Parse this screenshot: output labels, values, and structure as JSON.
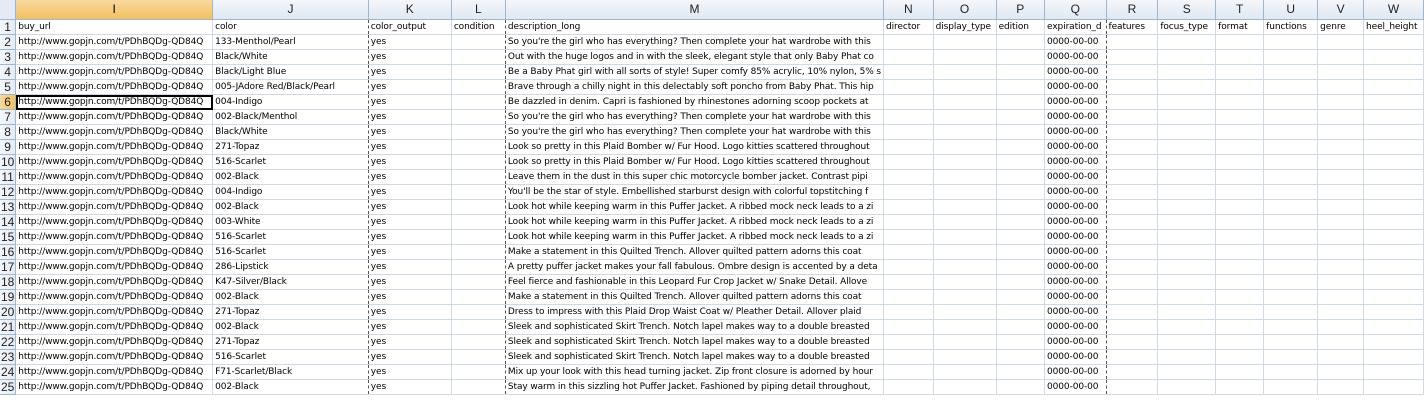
{
  "columns": [
    "I",
    "J",
    "K",
    "L",
    "M",
    "N",
    "O",
    "P",
    "Q",
    "R",
    "S",
    "T",
    "U",
    "V",
    "W"
  ],
  "headers": [
    "buy_url",
    "color",
    "color_output",
    "condition",
    "description_long",
    "director",
    "display_type",
    "edition",
    "expiration_d",
    "features",
    "focus_type",
    "format",
    "functions",
    "genre",
    "heel_height"
  ],
  "rows": [
    {
      "num": "1",
      "url": "buy_url",
      "color": "color",
      "out": "color_output",
      "desc": "description_long",
      "exp": "expiration_d"
    },
    {
      "num": "2",
      "url": "http://www.gopjn.com/t/PDhBQDg-QD84Q",
      "color": "133-Menthol/Pearl",
      "out": "yes",
      "desc": "So you're the girl who has everything? Then complete your hat wardrobe with this",
      "exp": "0000-00-00"
    },
    {
      "num": "3",
      "url": "http://www.gopjn.com/t/PDhBQDg-QD84Q",
      "color": "Black/White",
      "out": "yes",
      "desc": "Out with the huge logos and in with the sleek, elegant style that only Baby Phat co",
      "exp": "0000-00-00"
    },
    {
      "num": "4",
      "url": "http://www.gopjn.com/t/PDhBQDg-QD84Q",
      "color": "Black/Light Blue",
      "out": "yes",
      "desc": "Be a Baby Phat girl with all sorts of style! Super comfy 85% acrylic, 10% nylon, 5% s",
      "exp": "0000-00-00"
    },
    {
      "num": "5",
      "url": "http://www.gopjn.com/t/PDhBQDg-QD84Q",
      "color": "005-JAdore Red/Black/Pearl",
      "out": "yes",
      "desc": "Brave through a chilly night in this delectably soft poncho from Baby Phat. This hip",
      "exp": "0000-00-00"
    },
    {
      "num": "6",
      "url": "http://www.gopjn.com/t/PDhBQDg-QD84Q",
      "color": "004-Indigo",
      "out": "yes",
      "desc": "Be dazzled in denim.  Capri is fashioned by rhinestones adorning scoop pockets at",
      "exp": "0000-00-00"
    },
    {
      "num": "7",
      "url": "http://www.gopjn.com/t/PDhBQDg-QD84Q",
      "color": "002-Black/Menthol",
      "out": "yes",
      "desc": "So you're the girl who has everything? Then complete your hat wardrobe with this",
      "exp": "0000-00-00"
    },
    {
      "num": "8",
      "url": "http://www.gopjn.com/t/PDhBQDg-QD84Q",
      "color": "Black/White",
      "out": "yes",
      "desc": "So you're the girl who has everything? Then complete your hat wardrobe with this",
      "exp": "0000-00-00"
    },
    {
      "num": "9",
      "url": "http://www.gopjn.com/t/PDhBQDg-QD84Q",
      "color": "271-Topaz",
      "out": "yes",
      "desc": "Look so pretty in this Plaid Bomber w/ Fur Hood.  Logo kitties scattered throughout",
      "exp": "0000-00-00"
    },
    {
      "num": "10",
      "url": "http://www.gopjn.com/t/PDhBQDg-QD84Q",
      "color": "516-Scarlet",
      "out": "yes",
      "desc": "Look so pretty in this Plaid Bomber w/ Fur Hood.  Logo kitties scattered throughout",
      "exp": "0000-00-00"
    },
    {
      "num": "11",
      "url": "http://www.gopjn.com/t/PDhBQDg-QD84Q",
      "color": "002-Black",
      "out": "yes",
      "desc": "Leave them in the dust in this super chic motorcycle bomber jacket.  Contrast pipi",
      "exp": "0000-00-00"
    },
    {
      "num": "12",
      "url": "http://www.gopjn.com/t/PDhBQDg-QD84Q",
      "color": "004-Indigo",
      "out": "yes",
      "desc": "You'll be the star of style. Embellished starburst design with colorful topstitching f",
      "exp": "0000-00-00"
    },
    {
      "num": "13",
      "url": "http://www.gopjn.com/t/PDhBQDg-QD84Q",
      "color": "002-Black",
      "out": "yes",
      "desc": "Look hot while keeping warm in this Puffer Jacket.  A ribbed mock neck leads to a zi",
      "exp": "0000-00-00"
    },
    {
      "num": "14",
      "url": "http://www.gopjn.com/t/PDhBQDg-QD84Q",
      "color": "003-White",
      "out": "yes",
      "desc": "Look hot while keeping warm in this Puffer Jacket.  A ribbed mock neck leads to a zi",
      "exp": "0000-00-00"
    },
    {
      "num": "15",
      "url": "http://www.gopjn.com/t/PDhBQDg-QD84Q",
      "color": "516-Scarlet",
      "out": "yes",
      "desc": "Look hot while keeping warm in this Puffer Jacket.  A ribbed mock neck leads to a zi",
      "exp": "0000-00-00"
    },
    {
      "num": "16",
      "url": "http://www.gopjn.com/t/PDhBQDg-QD84Q",
      "color": "516-Scarlet",
      "out": "yes",
      "desc": "Make a statement in this Quilted Trench.  Allover quilted pattern adorns this coat",
      "exp": "0000-00-00"
    },
    {
      "num": "17",
      "url": "http://www.gopjn.com/t/PDhBQDg-QD84Q",
      "color": "286-Lipstick",
      "out": "yes",
      "desc": "A pretty puffer jacket makes your fall fabulous. Ombre design is accented by a deta",
      "exp": "0000-00-00"
    },
    {
      "num": "18",
      "url": "http://www.gopjn.com/t/PDhBQDg-QD84Q",
      "color": "K47-Silver/Black",
      "out": "yes",
      "desc": "Feel fierce and fashionable in this Leopard Fur Crop Jacket w/ Snake Detail.  Allove",
      "exp": "0000-00-00"
    },
    {
      "num": "19",
      "url": "http://www.gopjn.com/t/PDhBQDg-QD84Q",
      "color": "002-Black",
      "out": "yes",
      "desc": "Make a statement in this Quilted Trench.  Allover quilted pattern adorns this coat",
      "exp": "0000-00-00"
    },
    {
      "num": "20",
      "url": "http://www.gopjn.com/t/PDhBQDg-QD84Q",
      "color": "271-Topaz",
      "out": "yes",
      "desc": "Dress to impress with this Plaid Drop Waist Coat w/ Pleather Detail.  Allover plaid",
      "exp": "0000-00-00"
    },
    {
      "num": "21",
      "url": "http://www.gopjn.com/t/PDhBQDg-QD84Q",
      "color": "002-Black",
      "out": "yes",
      "desc": "Sleek and sophisticated Skirt Trench.  Notch lapel makes way to a double breasted",
      "exp": "0000-00-00"
    },
    {
      "num": "22",
      "url": "http://www.gopjn.com/t/PDhBQDg-QD84Q",
      "color": "271-Topaz",
      "out": "yes",
      "desc": "Sleek and sophisticated Skirt Trench.  Notch lapel makes way to a double breasted",
      "exp": "0000-00-00"
    },
    {
      "num": "23",
      "url": "http://www.gopjn.com/t/PDhBQDg-QD84Q",
      "color": "516-Scarlet",
      "out": "yes",
      "desc": "Sleek and sophisticated Skirt Trench.  Notch lapel makes way to a double breasted",
      "exp": "0000-00-00"
    },
    {
      "num": "24",
      "url": "http://www.gopjn.com/t/PDhBQDg-QD84Q",
      "color": "F71-Scarlet/Black",
      "out": "yes",
      "desc": "Mix up your look with this head turning jacket.  Zip front closure is adorned by hour",
      "exp": "0000-00-00"
    },
    {
      "num": "25",
      "url": "http://www.gopjn.com/t/PDhBQDg-QD84Q",
      "color": "002-Black",
      "out": "yes",
      "desc": "Stay warm in this sizzling hot Puffer Jacket.  Fashioned by piping detail throughout,",
      "exp": "0000-00-00"
    }
  ],
  "selected_column": "I",
  "selected_row": "6",
  "colors": {
    "selected_header": "#f1c15f",
    "gridline": "#d0d7e5",
    "header_border": "#9eb6ce"
  }
}
